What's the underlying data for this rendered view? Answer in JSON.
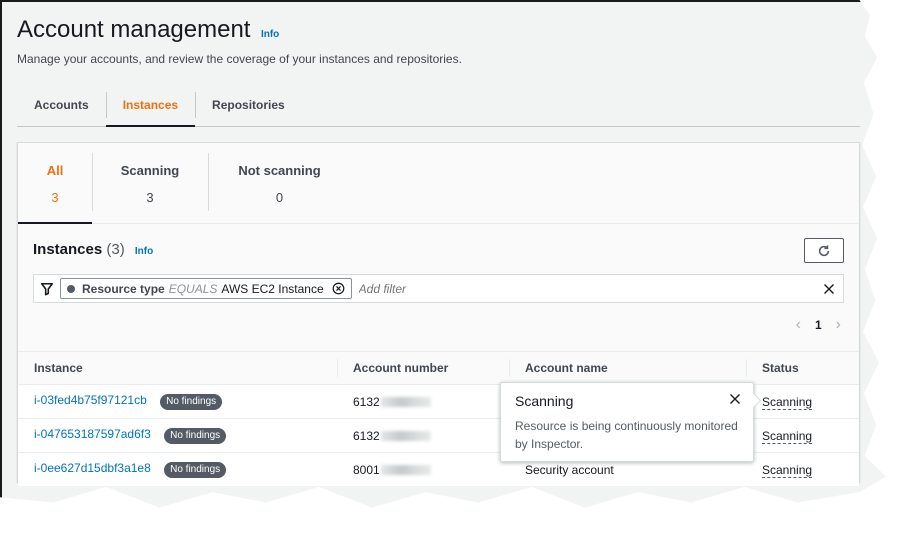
{
  "header": {
    "title": "Account management",
    "info_label": "Info",
    "subtitle": "Manage your accounts, and review the coverage of your instances and repositories."
  },
  "tabs": [
    {
      "label": "Accounts",
      "active": false
    },
    {
      "label": "Instances",
      "active": true
    },
    {
      "label": "Repositories",
      "active": false
    }
  ],
  "stat_tabs": [
    {
      "label": "All",
      "count": "3",
      "active": true
    },
    {
      "label": "Scanning",
      "count": "3",
      "active": false
    },
    {
      "label": "Not scanning",
      "count": "0",
      "active": false
    }
  ],
  "instances": {
    "title": "Instances",
    "count": "(3)",
    "info_label": "Info",
    "refresh_icon": "refresh-icon",
    "filter": {
      "icon": "filter-icon",
      "token": {
        "key": "Resource type",
        "operator": "EQUALS",
        "value": "AWS EC2 Instance"
      },
      "placeholder": "Add filter",
      "clear_icon": "close-icon"
    },
    "pagination": {
      "current_page": "1",
      "prev_icon": "chevron-left-icon",
      "next_icon": "chevron-right-icon"
    },
    "columns": [
      "Instance",
      "Account number",
      "Account name",
      "Status"
    ],
    "rows": [
      {
        "instance": "i-03fed4b75f97121cb",
        "badge": "No findings",
        "account_number": "6132",
        "account_name": "",
        "status": "Scanning"
      },
      {
        "instance": "i-047653187597ad6f3",
        "badge": "No findings",
        "account_number": "6132",
        "account_name": "",
        "status": "Scanning"
      },
      {
        "instance": "i-0ee627d15dbf3a1e8",
        "badge": "No findings",
        "account_number": "8001",
        "account_name": "Security account",
        "status": "Scanning"
      }
    ]
  },
  "popover": {
    "title": "Scanning",
    "body": "Resource is being continuously monitored by Inspector.",
    "close_icon": "close-icon"
  },
  "colors": {
    "accent_orange": "#ec7211",
    "link_blue": "#0073bb",
    "badge_gray": "#545b64"
  }
}
